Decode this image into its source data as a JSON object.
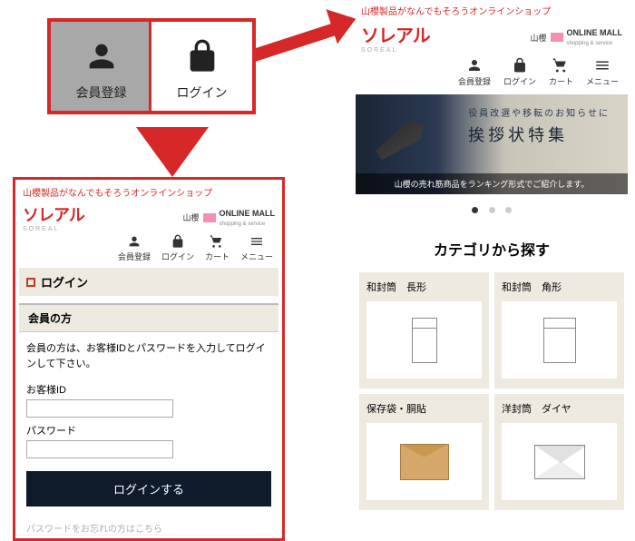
{
  "shop": {
    "tagline": "山櫻製品がなんでもそろうオンラインショップ",
    "logo": "ソレアル",
    "logo_sub": "SOREAL",
    "brand1": "山櫻",
    "brand2": "ONLINE MALL",
    "brand2_sub": "shopping & service"
  },
  "nav": {
    "register": "会員登録",
    "login": "ログイン",
    "cart": "カート",
    "menu": "メニュー"
  },
  "hero": {
    "line1": "役員改選や移転のお知らせに",
    "line2": "挨拶状特集",
    "caption": "山櫻の売れ筋商品をランキング形式でご紹介します。"
  },
  "categories": {
    "title": "カテゴリから探す",
    "items": [
      "和封筒　長形",
      "和封筒　角形",
      "保存袋・胴貼",
      "洋封筒　ダイヤ"
    ]
  },
  "callout": {
    "register": "会員登録",
    "login": "ログイン"
  },
  "login_page": {
    "title": "ログイン",
    "section": "会員の方",
    "instruction": "会員の方は、お客様IDとパスワードを入力してログインして下さい。",
    "id_label": "お客様ID",
    "pw_label": "パスワード",
    "button": "ログインする",
    "forgot": "パスワードをお忘れの方はこちら"
  }
}
